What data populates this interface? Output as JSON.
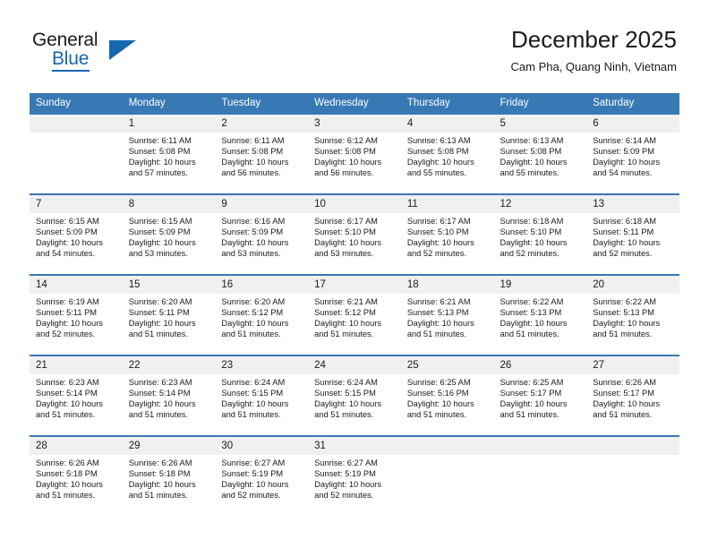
{
  "brand": {
    "name_primary": "General",
    "name_secondary": "Blue",
    "accent_color": "#1666b0"
  },
  "header": {
    "title": "December 2025",
    "subtitle": "Cam Pha, Quang Ninh, Vietnam"
  },
  "theme": {
    "header_bg": "#3878b4",
    "daynum_bg": "#f0f0f0",
    "row_border": "#3878b4",
    "text": "#1a1a1a"
  },
  "weekday_headers": [
    "Sunday",
    "Monday",
    "Tuesday",
    "Wednesday",
    "Thursday",
    "Friday",
    "Saturday"
  ],
  "labels": {
    "sunrise_prefix": "Sunrise:",
    "sunset_prefix": "Sunset:",
    "daylight_prefix": "Daylight:"
  },
  "weeks": [
    [
      {
        "day": "",
        "sunrise": "",
        "sunset": "",
        "daylight_line1": "",
        "daylight_line2": ""
      },
      {
        "day": "1",
        "sunrise": "Sunrise: 6:11 AM",
        "sunset": "Sunset: 5:08 PM",
        "daylight_line1": "Daylight: 10 hours",
        "daylight_line2": "and 57 minutes."
      },
      {
        "day": "2",
        "sunrise": "Sunrise: 6:11 AM",
        "sunset": "Sunset: 5:08 PM",
        "daylight_line1": "Daylight: 10 hours",
        "daylight_line2": "and 56 minutes."
      },
      {
        "day": "3",
        "sunrise": "Sunrise: 6:12 AM",
        "sunset": "Sunset: 5:08 PM",
        "daylight_line1": "Daylight: 10 hours",
        "daylight_line2": "and 56 minutes."
      },
      {
        "day": "4",
        "sunrise": "Sunrise: 6:13 AM",
        "sunset": "Sunset: 5:08 PM",
        "daylight_line1": "Daylight: 10 hours",
        "daylight_line2": "and 55 minutes."
      },
      {
        "day": "5",
        "sunrise": "Sunrise: 6:13 AM",
        "sunset": "Sunset: 5:08 PM",
        "daylight_line1": "Daylight: 10 hours",
        "daylight_line2": "and 55 minutes."
      },
      {
        "day": "6",
        "sunrise": "Sunrise: 6:14 AM",
        "sunset": "Sunset: 5:09 PM",
        "daylight_line1": "Daylight: 10 hours",
        "daylight_line2": "and 54 minutes."
      }
    ],
    [
      {
        "day": "7",
        "sunrise": "Sunrise: 6:15 AM",
        "sunset": "Sunset: 5:09 PM",
        "daylight_line1": "Daylight: 10 hours",
        "daylight_line2": "and 54 minutes."
      },
      {
        "day": "8",
        "sunrise": "Sunrise: 6:15 AM",
        "sunset": "Sunset: 5:09 PM",
        "daylight_line1": "Daylight: 10 hours",
        "daylight_line2": "and 53 minutes."
      },
      {
        "day": "9",
        "sunrise": "Sunrise: 6:16 AM",
        "sunset": "Sunset: 5:09 PM",
        "daylight_line1": "Daylight: 10 hours",
        "daylight_line2": "and 53 minutes."
      },
      {
        "day": "10",
        "sunrise": "Sunrise: 6:17 AM",
        "sunset": "Sunset: 5:10 PM",
        "daylight_line1": "Daylight: 10 hours",
        "daylight_line2": "and 53 minutes."
      },
      {
        "day": "11",
        "sunrise": "Sunrise: 6:17 AM",
        "sunset": "Sunset: 5:10 PM",
        "daylight_line1": "Daylight: 10 hours",
        "daylight_line2": "and 52 minutes."
      },
      {
        "day": "12",
        "sunrise": "Sunrise: 6:18 AM",
        "sunset": "Sunset: 5:10 PM",
        "daylight_line1": "Daylight: 10 hours",
        "daylight_line2": "and 52 minutes."
      },
      {
        "day": "13",
        "sunrise": "Sunrise: 6:18 AM",
        "sunset": "Sunset: 5:11 PM",
        "daylight_line1": "Daylight: 10 hours",
        "daylight_line2": "and 52 minutes."
      }
    ],
    [
      {
        "day": "14",
        "sunrise": "Sunrise: 6:19 AM",
        "sunset": "Sunset: 5:11 PM",
        "daylight_line1": "Daylight: 10 hours",
        "daylight_line2": "and 52 minutes."
      },
      {
        "day": "15",
        "sunrise": "Sunrise: 6:20 AM",
        "sunset": "Sunset: 5:11 PM",
        "daylight_line1": "Daylight: 10 hours",
        "daylight_line2": "and 51 minutes."
      },
      {
        "day": "16",
        "sunrise": "Sunrise: 6:20 AM",
        "sunset": "Sunset: 5:12 PM",
        "daylight_line1": "Daylight: 10 hours",
        "daylight_line2": "and 51 minutes."
      },
      {
        "day": "17",
        "sunrise": "Sunrise: 6:21 AM",
        "sunset": "Sunset: 5:12 PM",
        "daylight_line1": "Daylight: 10 hours",
        "daylight_line2": "and 51 minutes."
      },
      {
        "day": "18",
        "sunrise": "Sunrise: 6:21 AM",
        "sunset": "Sunset: 5:13 PM",
        "daylight_line1": "Daylight: 10 hours",
        "daylight_line2": "and 51 minutes."
      },
      {
        "day": "19",
        "sunrise": "Sunrise: 6:22 AM",
        "sunset": "Sunset: 5:13 PM",
        "daylight_line1": "Daylight: 10 hours",
        "daylight_line2": "and 51 minutes."
      },
      {
        "day": "20",
        "sunrise": "Sunrise: 6:22 AM",
        "sunset": "Sunset: 5:13 PM",
        "daylight_line1": "Daylight: 10 hours",
        "daylight_line2": "and 51 minutes."
      }
    ],
    [
      {
        "day": "21",
        "sunrise": "Sunrise: 6:23 AM",
        "sunset": "Sunset: 5:14 PM",
        "daylight_line1": "Daylight: 10 hours",
        "daylight_line2": "and 51 minutes."
      },
      {
        "day": "22",
        "sunrise": "Sunrise: 6:23 AM",
        "sunset": "Sunset: 5:14 PM",
        "daylight_line1": "Daylight: 10 hours",
        "daylight_line2": "and 51 minutes."
      },
      {
        "day": "23",
        "sunrise": "Sunrise: 6:24 AM",
        "sunset": "Sunset: 5:15 PM",
        "daylight_line1": "Daylight: 10 hours",
        "daylight_line2": "and 51 minutes."
      },
      {
        "day": "24",
        "sunrise": "Sunrise: 6:24 AM",
        "sunset": "Sunset: 5:15 PM",
        "daylight_line1": "Daylight: 10 hours",
        "daylight_line2": "and 51 minutes."
      },
      {
        "day": "25",
        "sunrise": "Sunrise: 6:25 AM",
        "sunset": "Sunset: 5:16 PM",
        "daylight_line1": "Daylight: 10 hours",
        "daylight_line2": "and 51 minutes."
      },
      {
        "day": "26",
        "sunrise": "Sunrise: 6:25 AM",
        "sunset": "Sunset: 5:17 PM",
        "daylight_line1": "Daylight: 10 hours",
        "daylight_line2": "and 51 minutes."
      },
      {
        "day": "27",
        "sunrise": "Sunrise: 6:26 AM",
        "sunset": "Sunset: 5:17 PM",
        "daylight_line1": "Daylight: 10 hours",
        "daylight_line2": "and 51 minutes."
      }
    ],
    [
      {
        "day": "28",
        "sunrise": "Sunrise: 6:26 AM",
        "sunset": "Sunset: 5:18 PM",
        "daylight_line1": "Daylight: 10 hours",
        "daylight_line2": "and 51 minutes."
      },
      {
        "day": "29",
        "sunrise": "Sunrise: 6:26 AM",
        "sunset": "Sunset: 5:18 PM",
        "daylight_line1": "Daylight: 10 hours",
        "daylight_line2": "and 51 minutes."
      },
      {
        "day": "30",
        "sunrise": "Sunrise: 6:27 AM",
        "sunset": "Sunset: 5:19 PM",
        "daylight_line1": "Daylight: 10 hours",
        "daylight_line2": "and 52 minutes."
      },
      {
        "day": "31",
        "sunrise": "Sunrise: 6:27 AM",
        "sunset": "Sunset: 5:19 PM",
        "daylight_line1": "Daylight: 10 hours",
        "daylight_line2": "and 52 minutes."
      },
      {
        "day": "",
        "sunrise": "",
        "sunset": "",
        "daylight_line1": "",
        "daylight_line2": ""
      },
      {
        "day": "",
        "sunrise": "",
        "sunset": "",
        "daylight_line1": "",
        "daylight_line2": ""
      },
      {
        "day": "",
        "sunrise": "",
        "sunset": "",
        "daylight_line1": "",
        "daylight_line2": ""
      }
    ]
  ]
}
